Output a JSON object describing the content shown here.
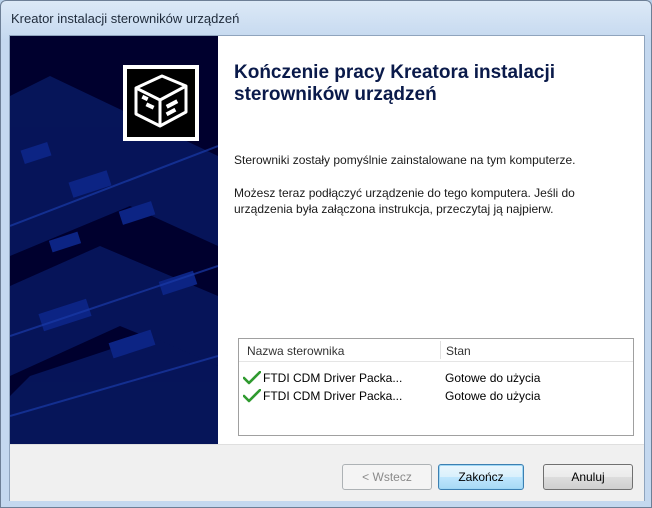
{
  "window": {
    "title": "Kreator instalacji sterowników urządzeń"
  },
  "main": {
    "heading": "Kończenie pracy Kreatora instalacji sterowników urządzeń",
    "paragraph1": "Sterowniki zostały pomyślnie zainstalowane na tym komputerze.",
    "paragraph2": "Możesz teraz podłączyć urządzenie do tego komputera. Jeśli do urządzenia była załączona instrukcja, przeczytaj ją najpierw."
  },
  "table": {
    "headers": [
      "Nazwa sterownika",
      "Stan"
    ],
    "rows": [
      {
        "icon": "checkmark-icon",
        "name": "FTDI CDM Driver Packa...",
        "status": "Gotowe do użycia"
      },
      {
        "icon": "checkmark-icon",
        "name": "FTDI CDM Driver Packa...",
        "status": "Gotowe do użycia"
      }
    ]
  },
  "buttons": {
    "back": "< Wstecz",
    "finish": "Zakończ",
    "cancel": "Anuluj"
  },
  "colors": {
    "side_panel": "#00002e",
    "checkmark": "#2f9a2f"
  }
}
